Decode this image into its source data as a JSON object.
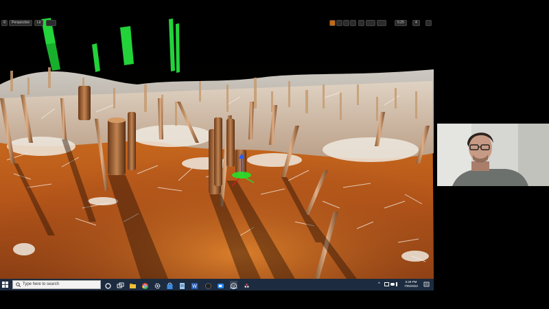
{
  "viewport": {
    "perspective_label": "Perspective",
    "lit_label": "Lit",
    "toolbar_right_value": "0.25",
    "toolbar_right_value2": "4"
  },
  "taskbar": {
    "search_placeholder": "Type here to search",
    "clock_time": "5:29 PM",
    "clock_date": "7/05/2022"
  },
  "icons": {
    "start": "windows-start-icon",
    "search": "search-icon",
    "notification": "notification-icon"
  },
  "colors": {
    "taskbar": "#1c2b3f",
    "ground_orange": "#c8621a",
    "marker_green": "#22d33a",
    "gizmo_green": "#28e028",
    "gizmo_blue": "#2a5cff"
  }
}
